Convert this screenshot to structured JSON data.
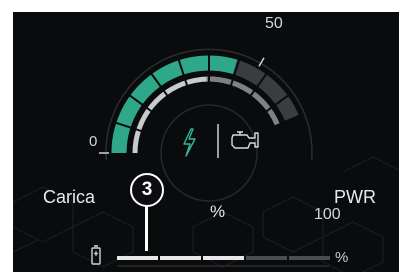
{
  "gauge": {
    "scale_min": "0",
    "scale_mid": "50",
    "scale_max": "100",
    "unit": "%",
    "fill_fraction": 0.68,
    "fill_color": "#2fa889",
    "track_color": "#3a3d40"
  },
  "labels": {
    "charge": "Carica",
    "power": "PWR"
  },
  "icons": {
    "electric": "lightning-icon",
    "engine": "engine-icon",
    "battery": "battery-icon"
  },
  "charge_bar": {
    "unit": "%",
    "segments_total": 5,
    "segments_lit": 3,
    "lit_color": "#e8e8e8",
    "unlit_color": "#4a4d50"
  },
  "callout": {
    "number": "3"
  }
}
